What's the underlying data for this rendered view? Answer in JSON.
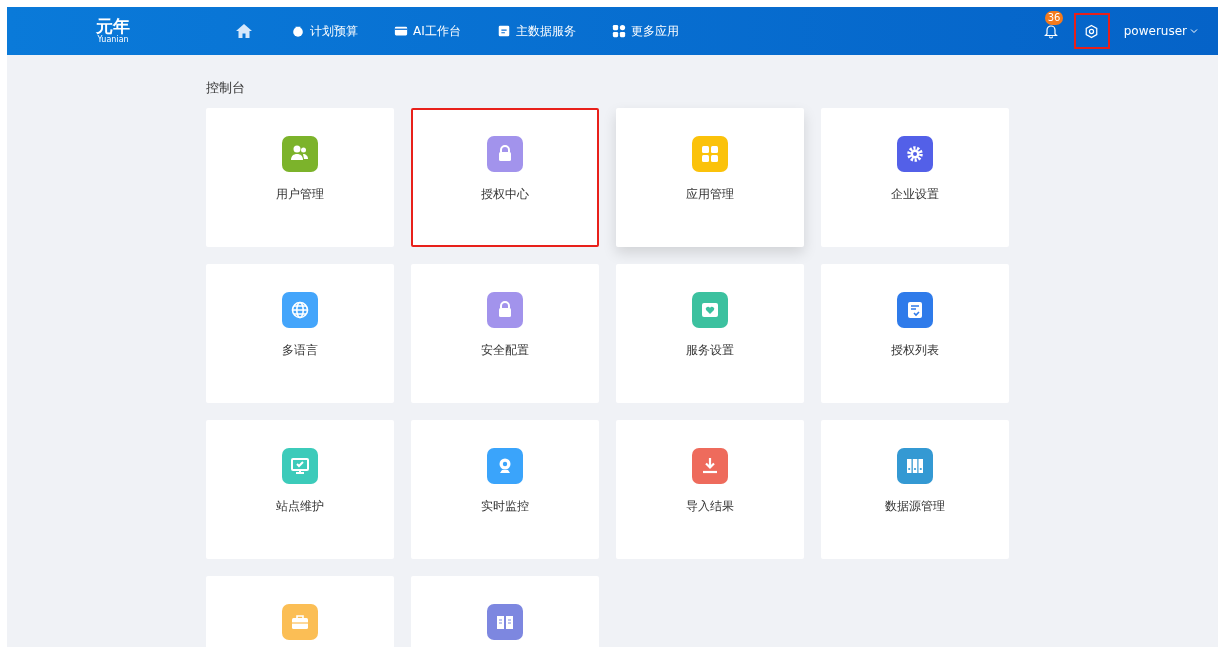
{
  "header": {
    "logo": {
      "title": "元年",
      "subtitle": "Yuanian"
    },
    "nav": [
      {
        "label": "计划预算"
      },
      {
        "label": "AI工作台"
      },
      {
        "label": "主数据服务"
      },
      {
        "label": "更多应用"
      }
    ],
    "notifications": {
      "badge": "36"
    },
    "settings": {
      "highlighted": true
    },
    "user": {
      "name": "poweruser"
    }
  },
  "section_title": "控制台",
  "tiles": [
    {
      "label": "用户管理",
      "color": "#7cb32b",
      "highlighted": false,
      "hovered": false
    },
    {
      "label": "授权中心",
      "color": "#a293ec",
      "highlighted": true,
      "hovered": false
    },
    {
      "label": "应用管理",
      "color": "#fbc20a",
      "highlighted": false,
      "hovered": true
    },
    {
      "label": "企业设置",
      "color": "#5360e8",
      "highlighted": false,
      "hovered": false
    },
    {
      "label": "多语言",
      "color": "#44a5fb",
      "highlighted": false,
      "hovered": false
    },
    {
      "label": "安全配置",
      "color": "#a293ec",
      "highlighted": false,
      "hovered": false
    },
    {
      "label": "服务设置",
      "color": "#3cc19f",
      "highlighted": false,
      "hovered": false
    },
    {
      "label": "授权列表",
      "color": "#2f7bea",
      "highlighted": false,
      "hovered": false
    },
    {
      "label": "站点维护",
      "color": "#3ccbba",
      "highlighted": false,
      "hovered": false
    },
    {
      "label": "实时监控",
      "color": "#3aa4fb",
      "highlighted": false,
      "hovered": false
    },
    {
      "label": "导入结果",
      "color": "#ee6b5c",
      "highlighted": false,
      "hovered": false
    },
    {
      "label": "数据源管理",
      "color": "#3499d3",
      "highlighted": false,
      "hovered": false
    },
    {
      "color": "#fbbe55",
      "highlighted": false,
      "hovered": false
    },
    {
      "color": "#7d87e0",
      "highlighted": false,
      "hovered": false
    }
  ]
}
